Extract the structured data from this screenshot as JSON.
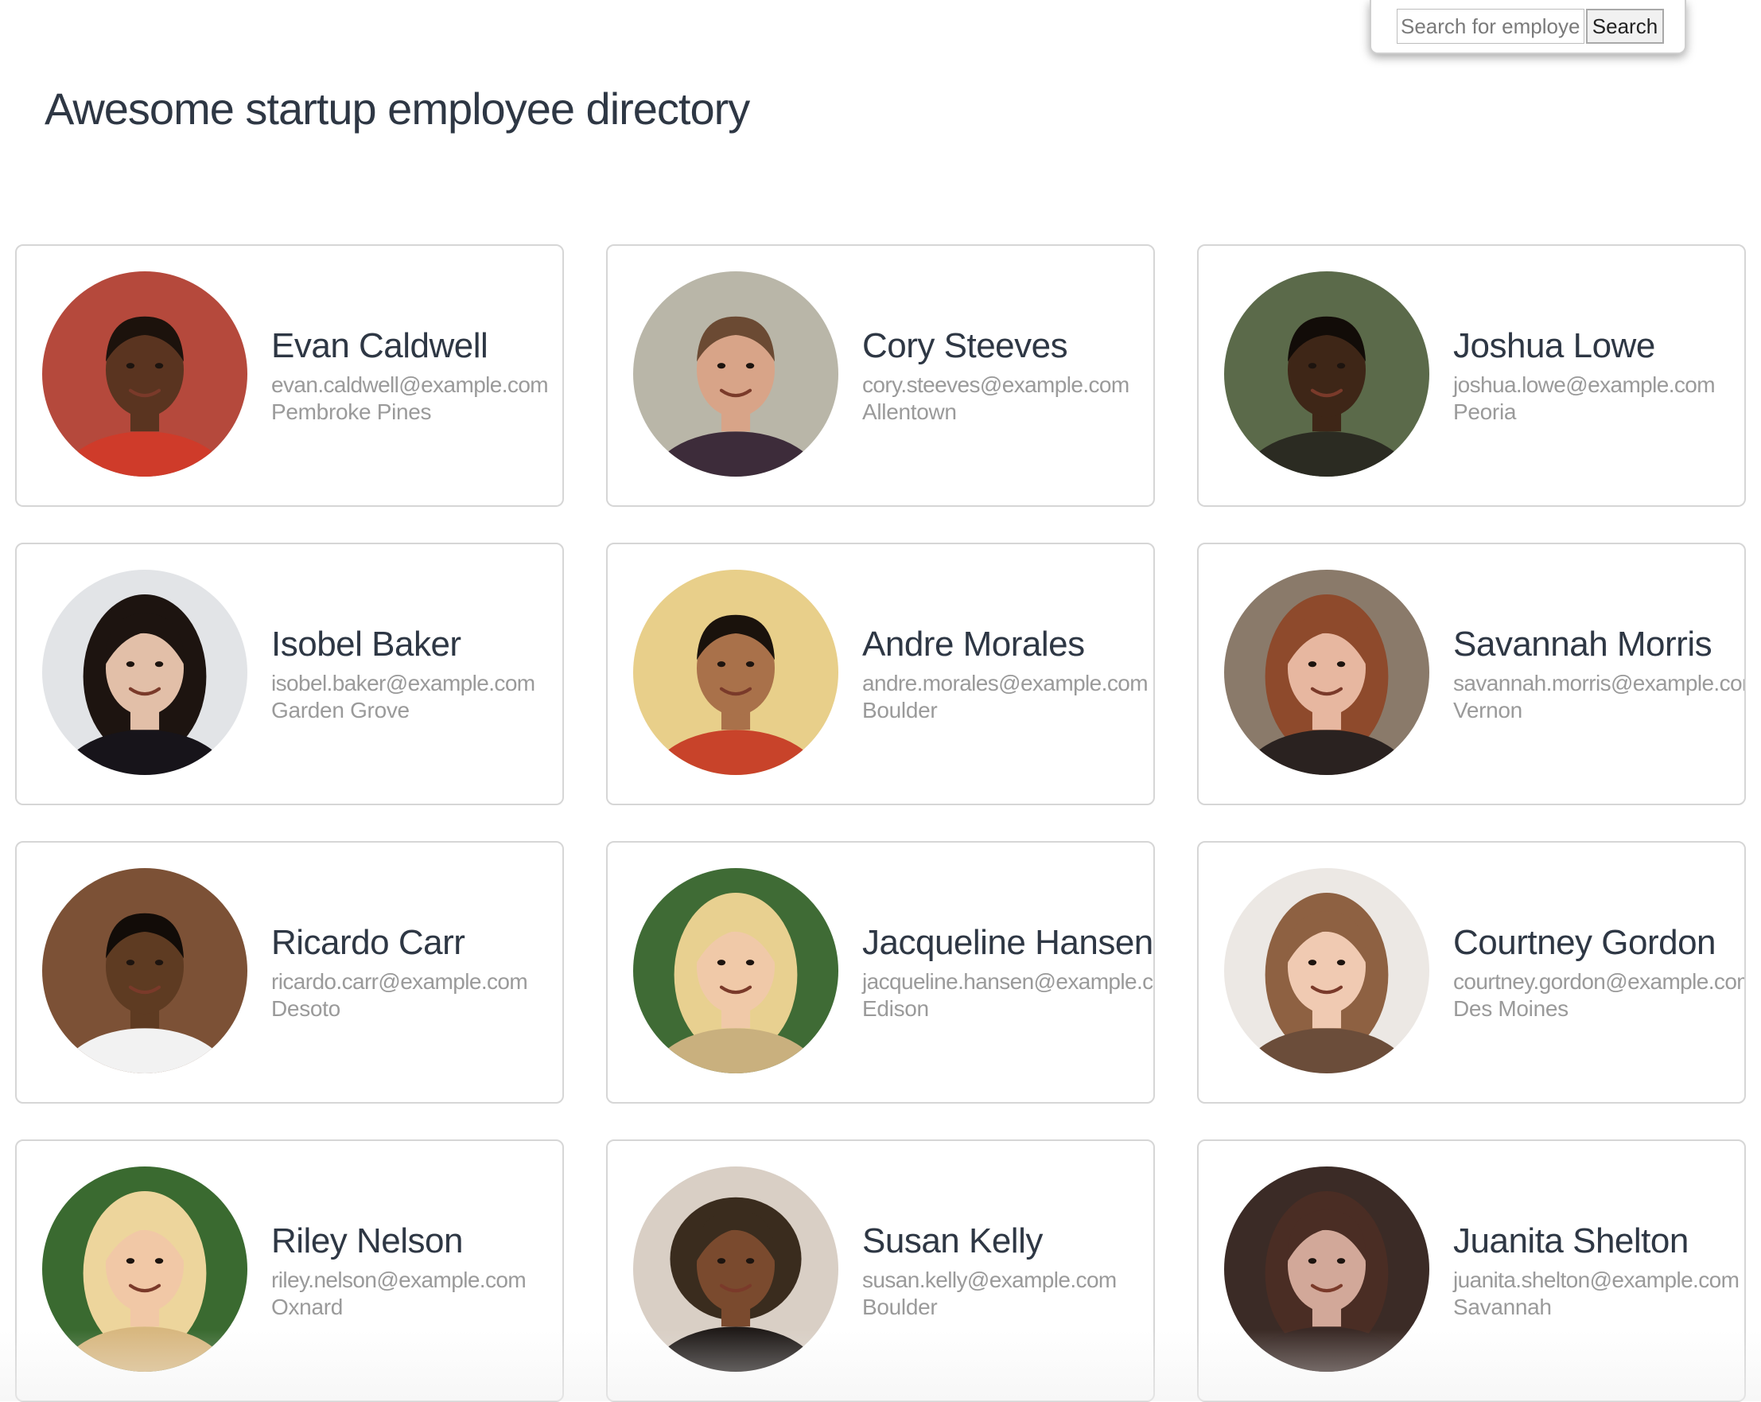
{
  "search": {
    "placeholder": "Search for employee",
    "value": "",
    "button_label": "Search"
  },
  "header": {
    "title": "Awesome startup employee directory"
  },
  "employees": [
    {
      "name": "Evan Caldwell",
      "email": "evan.caldwell@example.com",
      "city": "Pembroke Pines",
      "photo": {
        "bg": "#b5493c",
        "skin": "#5a3420",
        "hair": "#1c120c",
        "shirt": "#cf3b2a",
        "hair_style": "short"
      }
    },
    {
      "name": "Cory Steeves",
      "email": "cory.steeves@example.com",
      "city": "Allentown",
      "photo": {
        "bg": "#b9b6a8",
        "skin": "#d8a488",
        "hair": "#6b4a33",
        "shirt": "#3d2c3a",
        "hair_style": "short"
      }
    },
    {
      "name": "Joshua Lowe",
      "email": "joshua.lowe@example.com",
      "city": "Peoria",
      "photo": {
        "bg": "#5b6a4a",
        "skin": "#3e2617",
        "hair": "#120c08",
        "shirt": "#2b2b22",
        "hair_style": "short"
      }
    },
    {
      "name": "Isobel Baker",
      "email": "isobel.baker@example.com",
      "city": "Garden Grove",
      "photo": {
        "bg": "#e2e4e7",
        "skin": "#e2bfa8",
        "hair": "#1d1410",
        "shirt": "#17141a",
        "hair_style": "long"
      }
    },
    {
      "name": "Andre Morales",
      "email": "andre.morales@example.com",
      "city": "Boulder",
      "photo": {
        "bg": "#e8cf8a",
        "skin": "#a9714a",
        "hair": "#1a120c",
        "shirt": "#c8432a",
        "hair_style": "short"
      }
    },
    {
      "name": "Savannah Morris",
      "email": "savannah.morris@example.com",
      "city": "Vernon",
      "photo": {
        "bg": "#8a7a6a",
        "skin": "#e7b7a0",
        "hair": "#8e4a2c",
        "shirt": "#2a2220",
        "hair_style": "long"
      }
    },
    {
      "name": "Ricardo Carr",
      "email": "ricardo.carr@example.com",
      "city": "Desoto",
      "photo": {
        "bg": "#7c5136",
        "skin": "#5e3b22",
        "hair": "#120c08",
        "shirt": "#f2f2f2",
        "hair_style": "short"
      }
    },
    {
      "name": "Jacqueline Hansen",
      "email": "jacqueline.hansen@example.com",
      "city": "Edison",
      "photo": {
        "bg": "#3f6b35",
        "skin": "#f0c9a8",
        "hair": "#e8d090",
        "shirt": "#c9b07e",
        "hair_style": "long"
      }
    },
    {
      "name": "Courtney Gordon",
      "email": "courtney.gordon@example.com",
      "city": "Des Moines",
      "photo": {
        "bg": "#ece8e4",
        "skin": "#f0cab2",
        "hair": "#8e6142",
        "shirt": "#6b4d3a",
        "hair_style": "long"
      }
    },
    {
      "name": "Riley Nelson",
      "email": "riley.nelson@example.com",
      "city": "Oxnard",
      "photo": {
        "bg": "#3a6a30",
        "skin": "#f1c8a6",
        "hair": "#edd59c",
        "shirt": "#d8b77f",
        "hair_style": "long"
      }
    },
    {
      "name": "Susan Kelly",
      "email": "susan.kelly@example.com",
      "city": "Boulder",
      "photo": {
        "bg": "#d9cfc5",
        "skin": "#7a4a2e",
        "hair": "#3a2c1e",
        "shirt": "#1f1a18",
        "hair_style": "curly"
      }
    },
    {
      "name": "Juanita Shelton",
      "email": "juanita.shelton@example.com",
      "city": "Savannah",
      "photo": {
        "bg": "#3b2b26",
        "skin": "#d2a899",
        "hair": "#4a2d24",
        "shirt": "#3a2a26",
        "hair_style": "long"
      }
    }
  ]
}
